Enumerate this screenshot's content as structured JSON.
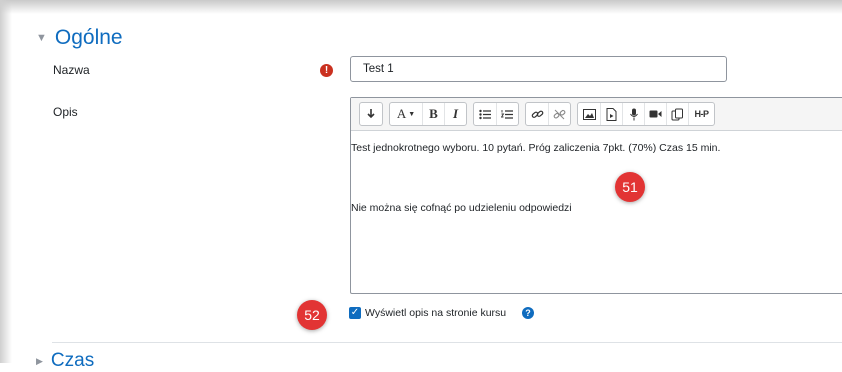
{
  "section": {
    "title": "Ogólne"
  },
  "fields": {
    "name_label": "Nazwa",
    "name_value": "Test 1",
    "desc_label": "Opis"
  },
  "required_icon": "!",
  "editor": {
    "toolbar": [
      "insert-paragraph-icon",
      "font-color-icon",
      "bold-icon",
      "italic-icon",
      "unordered-list-icon",
      "ordered-list-icon",
      "link-icon",
      "unlink-icon",
      "image-icon",
      "media-file-icon",
      "record-audio-icon",
      "record-video-icon",
      "manage-files-icon",
      "h5p-icon"
    ],
    "bold": "B",
    "italic": "I",
    "font_a": "A",
    "h5p": "H-P",
    "paragraph1": "Test jednokrotnego wyboru. 10 pytań. Próg zaliczenia 7pkt. (70%) Czas 15 min.",
    "paragraph2": "Nie można się cofnąć po udzieleniu odpowiedzi"
  },
  "badges": {
    "b51": "51",
    "b52": "52"
  },
  "checkbox": {
    "checked": true,
    "label": "Wyświetl opis na stronie kursu",
    "help": "?"
  },
  "next_section": {
    "title": "Czas"
  },
  "colors": {
    "accent": "#0f6cbf",
    "badge": "#e23434",
    "required": "#ca3120"
  }
}
